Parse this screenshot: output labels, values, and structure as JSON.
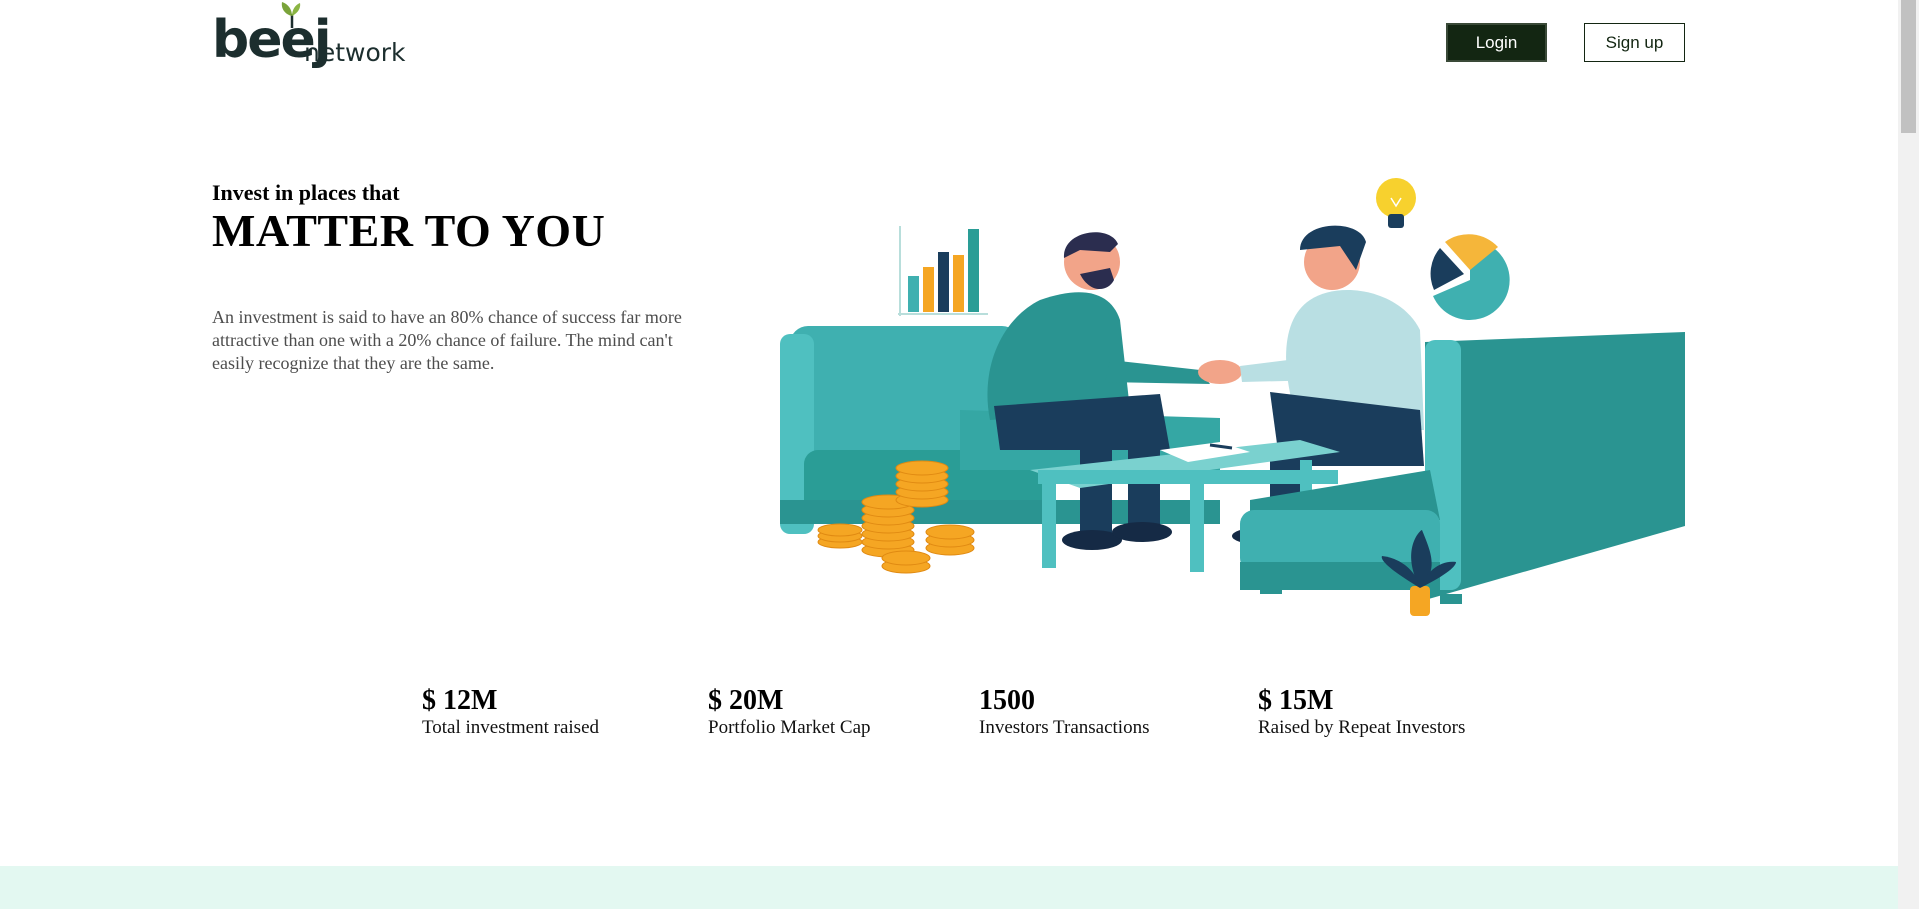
{
  "header": {
    "logo_text": "beej",
    "logo_sub": "network",
    "login_label": "Login",
    "signup_label": "Sign up"
  },
  "hero": {
    "tagline": "Invest in places that",
    "headline": "MATTER TO YOU",
    "description": "An investment is said to have an 80% chance of success far more attractive than one with a 20% chance of failure. The mind can't easily recognize that they are the same."
  },
  "stats": [
    {
      "value": "$ 12M",
      "label": "Total investment raised"
    },
    {
      "value": "$ 20M",
      "label": "Portfolio Market Cap"
    },
    {
      "value": "1500",
      "label": "Investors Transactions"
    },
    {
      "value": "$ 15M",
      "label": "Raised by Repeat Investors"
    }
  ],
  "colors": {
    "brand_dark": "#132612",
    "teal": "#3fb0b0",
    "band": "#e3f8f1",
    "coin": "#f5a623"
  },
  "illustration": {
    "icons": [
      "bar-chart-icon",
      "lightbulb-icon",
      "pie-chart-icon",
      "coins-icon",
      "plant-icon"
    ]
  }
}
